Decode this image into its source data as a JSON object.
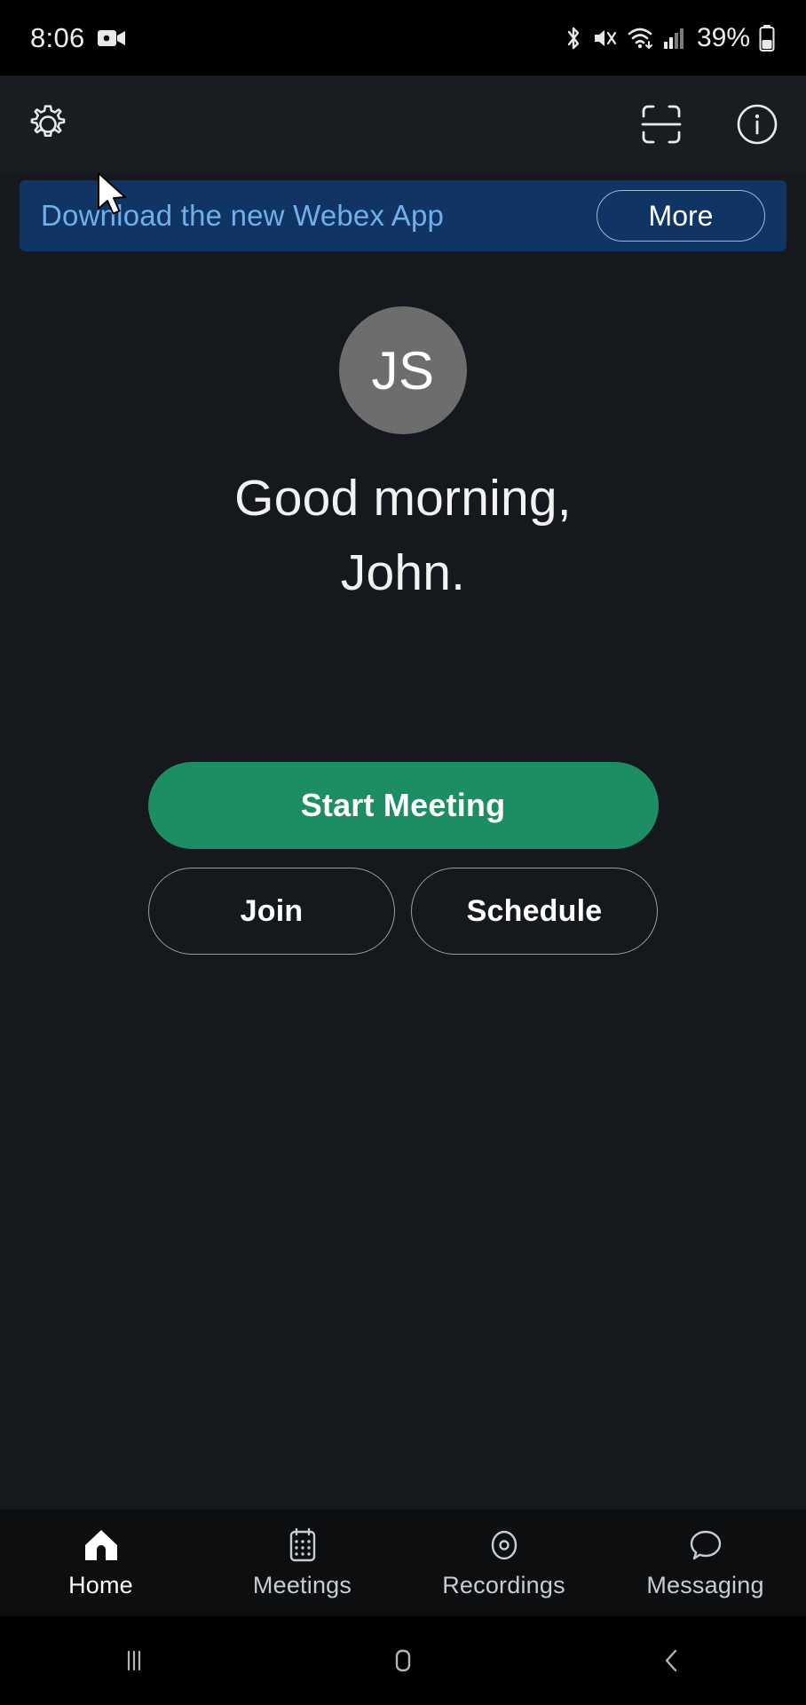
{
  "status_bar": {
    "time": "8:06",
    "battery_percent": "39%",
    "icons": [
      "video-recording-icon",
      "bluetooth-icon",
      "mute-icon",
      "wifi-icon",
      "cellular-signal-icon",
      "battery-icon"
    ]
  },
  "app_bar": {
    "settings_icon": "gear-icon",
    "scan_icon": "scan-code-icon",
    "info_icon": "info-circle-icon"
  },
  "banner": {
    "text": "Download the new Webex App",
    "button_label": "More",
    "background_color": "#103463",
    "text_color": "#6fb0ea"
  },
  "profile": {
    "initials": "JS",
    "avatar_color": "#6d6d6d"
  },
  "greeting": {
    "line1": "Good morning,",
    "line2": "John."
  },
  "actions": {
    "primary_label": "Start Meeting",
    "primary_color": "#1d8e63",
    "join_label": "Join",
    "schedule_label": "Schedule"
  },
  "tab_bar": {
    "items": [
      {
        "label": "Home",
        "icon": "home-icon",
        "active": true
      },
      {
        "label": "Meetings",
        "icon": "calendar-icon",
        "active": false
      },
      {
        "label": "Recordings",
        "icon": "record-circle-icon",
        "active": false
      },
      {
        "label": "Messaging",
        "icon": "speech-bubble-icon",
        "active": false
      }
    ]
  },
  "system_nav": {
    "recents": "recents-icon",
    "home": "home-square-icon",
    "back": "back-chevron-icon"
  }
}
